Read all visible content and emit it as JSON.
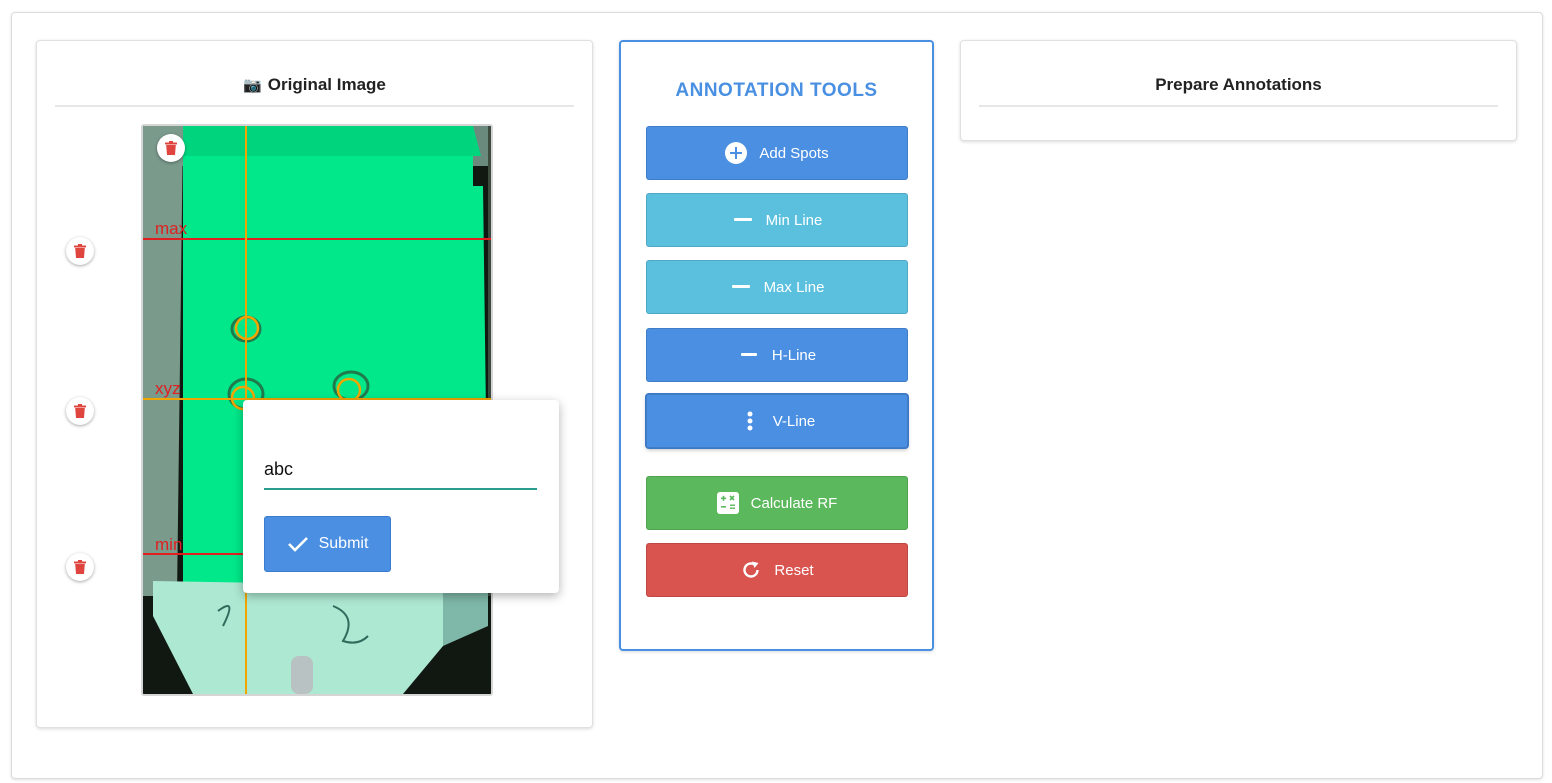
{
  "original": {
    "title": "Original Image",
    "camera_icon": "📷",
    "labels": {
      "max": "max",
      "xyz": "xyz",
      "min": "min"
    }
  },
  "tools": {
    "title": "ANNOTATION TOOLS",
    "add_spots": "Add Spots",
    "min_line": "Min Line",
    "max_line": "Max Line",
    "h_line": "H-Line",
    "v_line": "V-Line",
    "calculate_rf": "Calculate RF",
    "reset": "Reset"
  },
  "prepare": {
    "title": "Prepare Annotations"
  },
  "popup": {
    "input_value": "abc",
    "submit": "Submit"
  },
  "colors": {
    "blue": "#4a8fe2",
    "light_blue": "#5bc0de",
    "green": "#5cb85c",
    "red": "#d9534f",
    "plate_green": "#00e88a",
    "annotation_red": "#e02020",
    "annotation_orange": "#f0a500"
  }
}
